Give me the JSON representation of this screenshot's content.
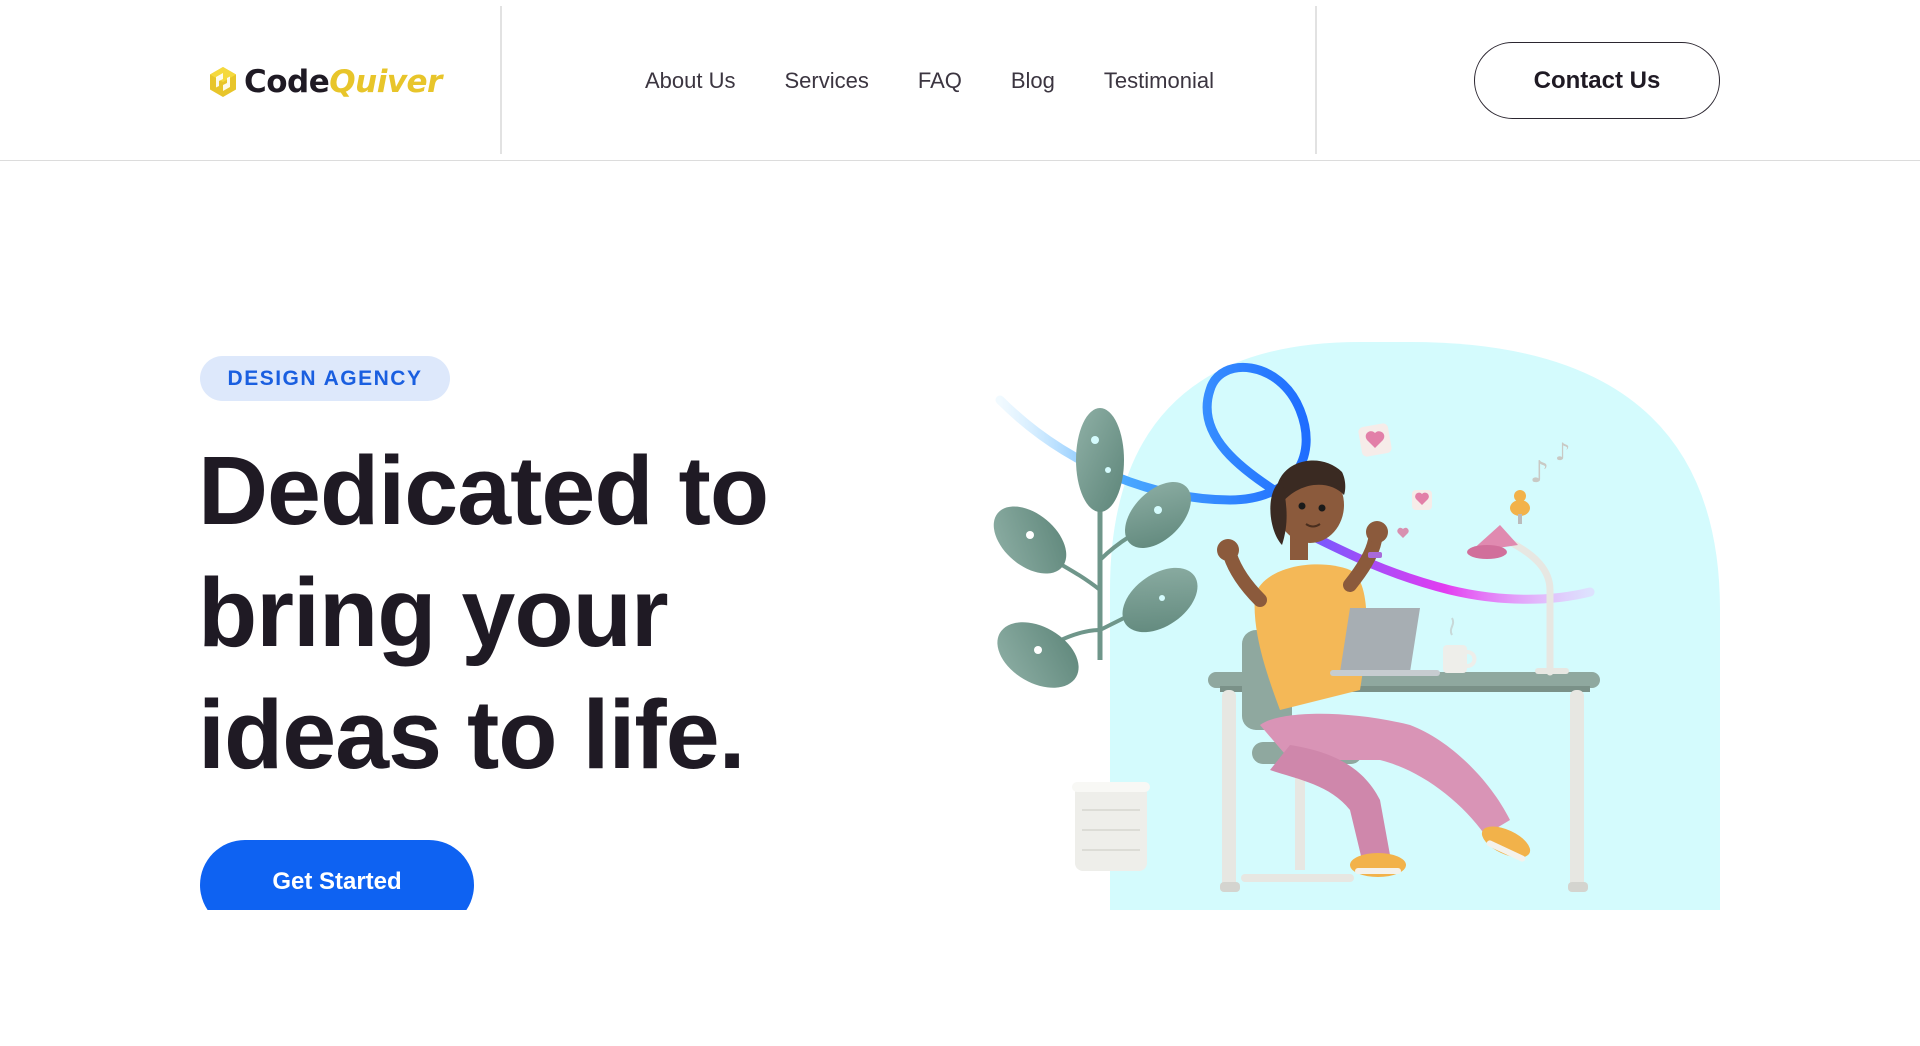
{
  "brand": {
    "name_part1": "Code",
    "name_part2": "Quiver",
    "colors": {
      "accent": "#e8c52a",
      "dark": "#1f1a24",
      "primary": "#0e62f2"
    }
  },
  "nav": {
    "items": [
      {
        "label": "About Us"
      },
      {
        "label": "Services"
      },
      {
        "label": "FAQ"
      },
      {
        "label": "Blog"
      },
      {
        "label": "Testimonial"
      }
    ]
  },
  "header": {
    "contact_label": "Contact Us"
  },
  "hero": {
    "badge": "DESIGN AGENCY",
    "headline_lines": [
      "Dedicated to",
      "bring your",
      "ideas to life."
    ],
    "cta_label": "Get Started",
    "illustration_icon": "woman-at-desk-illustration"
  }
}
